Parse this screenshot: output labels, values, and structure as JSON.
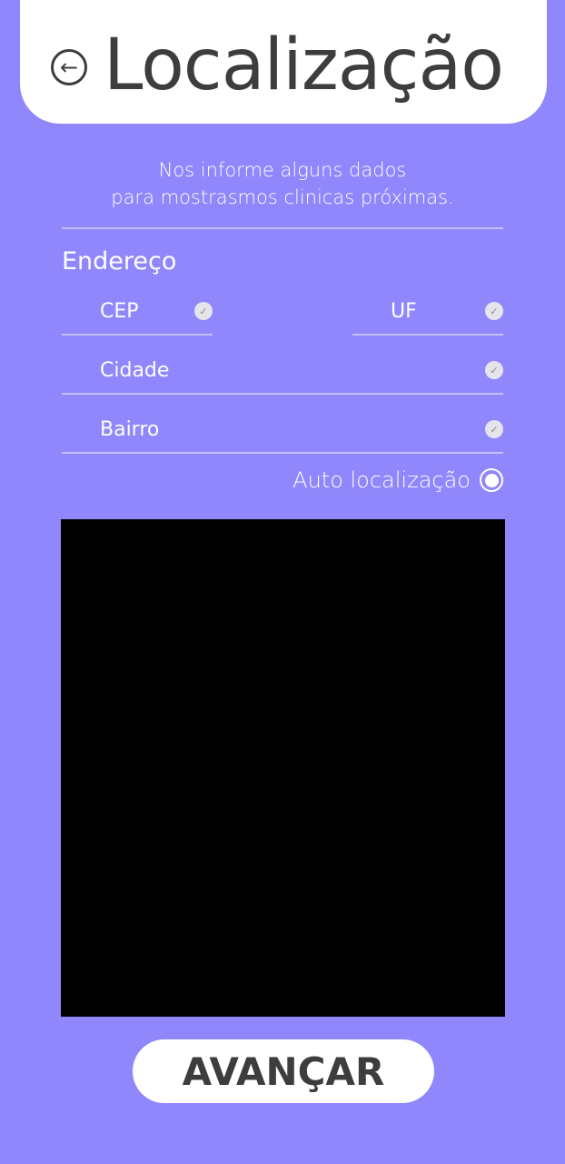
{
  "header": {
    "title": "Localização",
    "back_icon": "arrow-left-circle-icon"
  },
  "subtitle": {
    "line1": "Nos informe alguns dados",
    "line2": "para mostrasmos clinicas próximas."
  },
  "form": {
    "section_title": "Endereço",
    "fields": [
      {
        "label": "CEP"
      },
      {
        "label": "UF"
      },
      {
        "label": "Cidade"
      },
      {
        "label": "Bairro"
      }
    ],
    "check_icon": "check-circle-icon",
    "auto_location": {
      "label": "Auto localização",
      "selected": true
    }
  },
  "submit_label": "AVANÇAR",
  "colors": {
    "background": "#9087fd",
    "header": "#ffffff",
    "text_dark": "#3d3d3d",
    "map": "#000000"
  }
}
